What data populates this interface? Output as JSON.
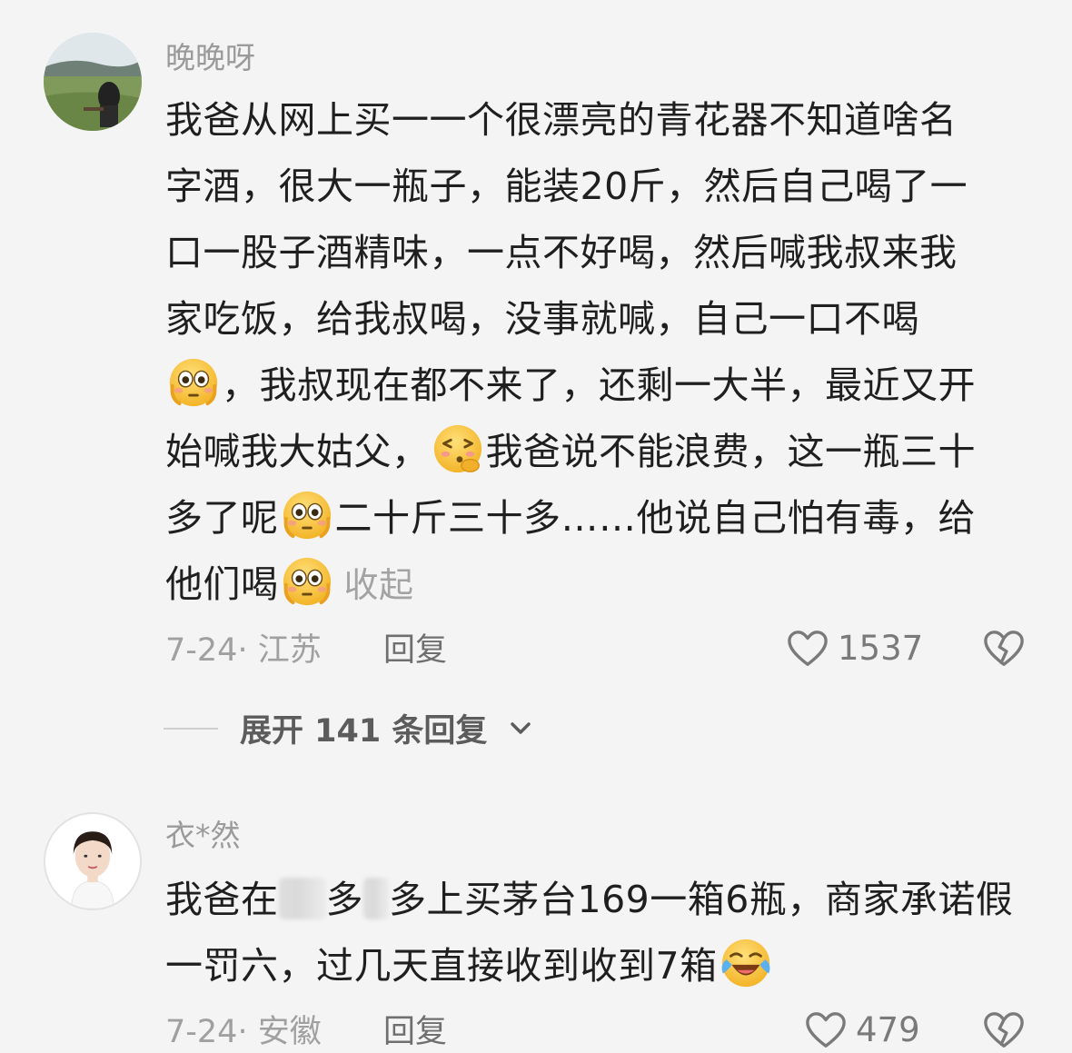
{
  "comments": [
    {
      "username": "晚晚呀",
      "lines": [
        "我爸从网上买一一个很漂亮的青花器不知道啥名",
        "字酒，很大一瓶子，能装20斤，然后自己喝了一",
        "口一股子酒精味，一点不好喝，然后喊我叔来我",
        "家吃饭，给我叔喝，没事就喊，自己一口不喝"
      ],
      "line5": "，我叔现在都不来了，还剩一大半，最近又开",
      "line6a": "始喊我大姑父，",
      "line6b": "我爸说不能浪费，这一瓶三十",
      "line7a": "多了呢",
      "line7b": "二十斤三十多……他说自己怕有毒，给",
      "line8a": "他们喝",
      "collapse_label": "收起",
      "date": "7-24",
      "location": "· 江苏",
      "reply_label": "回复",
      "likes": "1537",
      "expand_label": "展开 141 条回复"
    },
    {
      "username": "衣*然",
      "line1a": "我爸在",
      "line1b": "多",
      "line1c": "多上买茅台169一箱6瓶，商家承诺假",
      "line2": "一罚六，过几天直接收到收到7箱",
      "date": "7-24",
      "location": "· 安徽",
      "reply_label": "回复",
      "likes": "479"
    }
  ],
  "icons": {
    "like": "heart-outline-icon",
    "dislike": "broken-heart-icon",
    "expand": "chevron-down-icon",
    "emoji_flushed": "flushed-face-emoji",
    "emoji_shy": "shy-face-emoji",
    "emoji_laugh": "laughing-crying-emoji"
  },
  "colors": {
    "background": "#f4f4f4",
    "text": "#1f1f1f",
    "muted": "#a0a0a0",
    "emoji_yellow": "#f7c83f"
  }
}
